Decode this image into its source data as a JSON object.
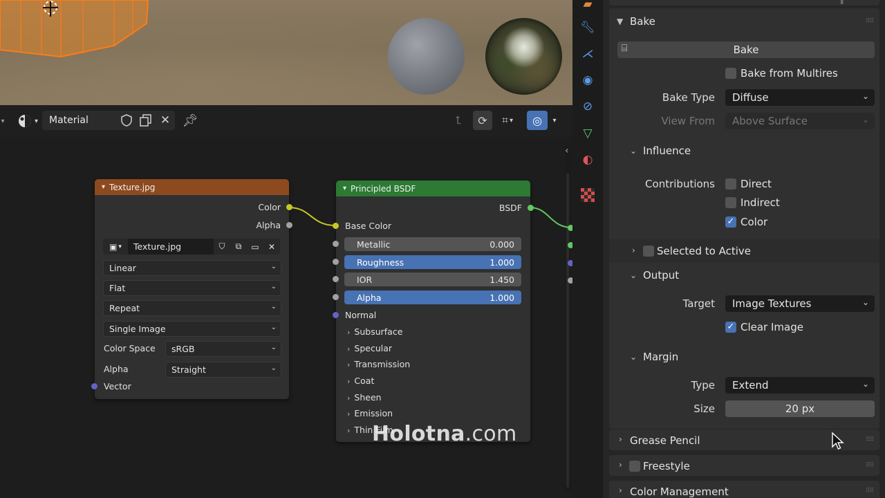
{
  "node_header": {
    "material_label": "Material"
  },
  "nodes": {
    "texture": {
      "title": "Texture.jpg",
      "outputs": [
        "Color",
        "Alpha"
      ],
      "image_name": "Texture.jpg",
      "interpolation": "Linear",
      "projection": "Flat",
      "extension": "Repeat",
      "source": "Single Image",
      "color_space_label": "Color Space",
      "color_space": "sRGB",
      "alpha_label": "Alpha",
      "alpha_mode": "Straight",
      "vector_label": "Vector",
      "header_color": "#8d4a1f"
    },
    "bsdf": {
      "title": "Principled BSDF",
      "output": "BSDF",
      "base_color_label": "Base Color",
      "sliders": [
        {
          "label": "Metallic",
          "value": "0.000",
          "active": false
        },
        {
          "label": "Roughness",
          "value": "1.000",
          "active": true
        },
        {
          "label": "IOR",
          "value": "1.450",
          "active": false
        },
        {
          "label": "Alpha",
          "value": "1.000",
          "active": true
        }
      ],
      "normal_label": "Normal",
      "subpanels": [
        "Subsurface",
        "Specular",
        "Transmission",
        "Coat",
        "Sheen",
        "Emission",
        "Thin Film"
      ],
      "header_color": "#2c7a34"
    }
  },
  "properties": {
    "bake_section": "Bake",
    "bake_button": "Bake",
    "bake_from_multires": "Bake from Multires",
    "bake_type_label": "Bake Type",
    "bake_type": "Diffuse",
    "view_from_label": "View From",
    "view_from": "Above Surface",
    "influence_section": "Influence",
    "contributions_label": "Contributions",
    "contrib_direct": "Direct",
    "contrib_indirect": "Indirect",
    "contrib_color": "Color",
    "selected_to_active": "Selected to Active",
    "output_section": "Output",
    "target_label": "Target",
    "target": "Image Textures",
    "clear_image": "Clear Image",
    "margin_section": "Margin",
    "margin_type_label": "Type",
    "margin_type": "Extend",
    "margin_size_label": "Size",
    "margin_size": "20 px",
    "grease_pencil": "Grease Pencil",
    "freestyle": "Freestyle",
    "color_management": "Color Management"
  },
  "watermark": {
    "bold": "Holotna",
    "rest": ".com"
  },
  "colors": {
    "accent_blue": "#4772b3",
    "selection_orange": "#ff7a1a"
  }
}
